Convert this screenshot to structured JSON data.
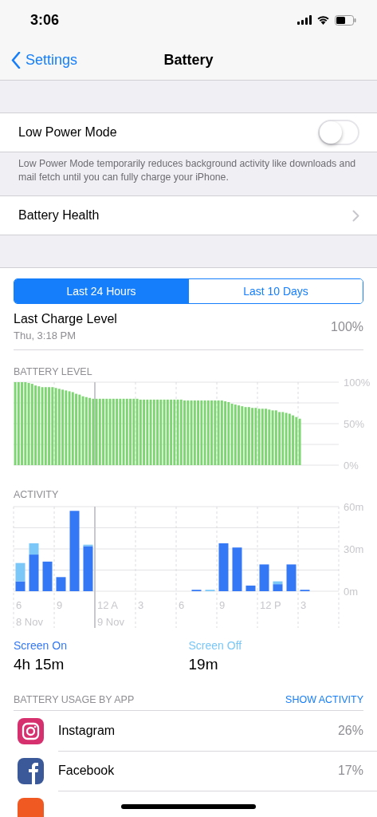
{
  "status_bar": {
    "time": "3:06"
  },
  "nav": {
    "back": "Settings",
    "title": "Battery"
  },
  "low_power": {
    "label": "Low Power Mode",
    "on": false,
    "footer": "Low Power Mode temporarily reduces background activity like downloads and mail fetch until you can fully charge your iPhone."
  },
  "battery_health": {
    "label": "Battery Health"
  },
  "tabs": [
    {
      "label": "Last 24 Hours",
      "selected": true
    },
    {
      "label": "Last 10 Days",
      "selected": false
    }
  ],
  "last_charge": {
    "label": "Last Charge Level",
    "time": "Thu, 3:18 PM",
    "value": "100%"
  },
  "battery_level": {
    "title": "BATTERY LEVEL",
    "chart_data": {
      "type": "bar",
      "color": "#7ed673",
      "ylim": [
        0,
        100
      ],
      "yticks": [
        {
          "value": 100,
          "label": "100%"
        },
        {
          "value": 50,
          "label": "50%"
        },
        {
          "value": 0,
          "label": "0%"
        }
      ],
      "values": [
        100,
        100,
        100,
        100,
        99,
        98,
        96,
        95,
        94,
        94,
        94,
        94,
        93,
        92,
        91,
        90,
        89,
        88,
        86,
        85,
        83,
        82,
        81,
        80,
        80,
        80,
        80,
        80,
        80,
        80,
        80,
        80,
        80,
        80,
        80,
        80,
        80,
        79,
        79,
        79,
        79,
        79,
        79,
        79,
        79,
        79,
        79,
        79,
        79,
        79,
        78,
        78,
        78,
        78,
        78,
        78,
        78,
        78,
        78,
        78,
        78,
        78,
        77,
        76,
        74,
        73,
        72,
        71,
        70,
        70,
        69,
        69,
        68,
        68,
        68,
        67,
        66,
        66,
        64,
        64,
        63,
        62,
        60,
        58,
        56
      ]
    }
  },
  "activity": {
    "title": "ACTIVITY",
    "chart_data": {
      "type": "bar",
      "stacked": true,
      "categories": [
        "6",
        null,
        null,
        "9",
        null,
        null,
        "12 A",
        null,
        null,
        "3",
        null,
        null,
        "6",
        null,
        null,
        "9",
        null,
        null,
        "12 P",
        null,
        null,
        "3",
        null,
        null
      ],
      "ylim": [
        0,
        60
      ],
      "yticks": [
        {
          "value": 60,
          "label": "60m"
        },
        {
          "value": 30,
          "label": "30m"
        },
        {
          "value": 0,
          "label": "0m"
        }
      ],
      "annotations": [
        "8 Nov",
        "9 Nov"
      ],
      "series": [
        {
          "name": "Screen On",
          "color": "#3478f6",
          "values": [
            7,
            26,
            21,
            10,
            57,
            32,
            0,
            0,
            0,
            0,
            0,
            0,
            0,
            1,
            0,
            34,
            31,
            4,
            19,
            5,
            19,
            1,
            null,
            null
          ]
        },
        {
          "name": "Screen Off",
          "color": "#7ac7f8",
          "values": [
            13,
            8,
            0,
            0,
            0,
            1,
            0,
            0,
            0,
            0,
            0,
            0,
            0,
            0,
            1,
            0,
            0,
            0,
            0,
            2,
            0,
            0,
            null,
            null
          ]
        }
      ]
    },
    "totals": [
      "4h 15m",
      "19m"
    ]
  },
  "usage": {
    "title": "BATTERY USAGE BY APP",
    "action": "SHOW ACTIVITY",
    "apps": [
      {
        "kind": "camera",
        "color": "#d6306f",
        "name": "Instagram",
        "percent": "26%"
      },
      {
        "kind": "f",
        "color": "#3b5998",
        "name": "Facebook",
        "percent": "17%"
      },
      {
        "kind": "partial",
        "color": "#f05a22"
      }
    ]
  }
}
